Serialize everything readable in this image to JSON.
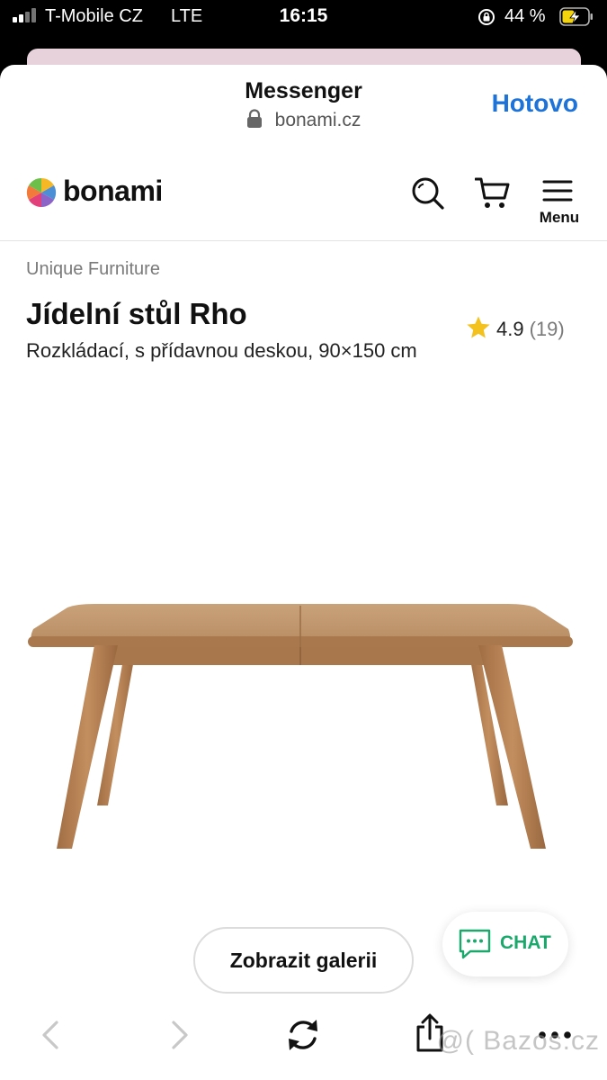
{
  "status_bar": {
    "carrier": "T-Mobile CZ",
    "network": "LTE",
    "time": "16:15",
    "battery_percent": "44 %",
    "signal_bars": 4,
    "icons": [
      "signal-icon",
      "rotation-lock-icon",
      "battery-charging-icon"
    ]
  },
  "nav": {
    "title": "Messenger",
    "url": "bonami.cz",
    "done_label": "Hotovo"
  },
  "site_header": {
    "logo_text": "bonami",
    "menu_label": "Menu",
    "icons": [
      "search-icon",
      "cart-icon",
      "hamburger-icon"
    ]
  },
  "product": {
    "brand": "Unique Furniture",
    "title": "Jídelní stůl Rho",
    "subtitle": "Rozkládací, s přídavnou deskou, 90×150 cm",
    "rating": "4.9",
    "rating_count": "(19)"
  },
  "actions": {
    "gallery_label": "Zobrazit galerii",
    "chat_label": "CHAT"
  },
  "toolbar": {
    "icons": [
      "back-icon",
      "forward-icon",
      "reload-icon",
      "share-icon",
      "more-icon"
    ]
  },
  "watermark": "@( Bazos.cz",
  "colors": {
    "accent_blue": "#1d73d8",
    "chat_green": "#1aa86c",
    "star_yellow": "#f4c21f"
  }
}
